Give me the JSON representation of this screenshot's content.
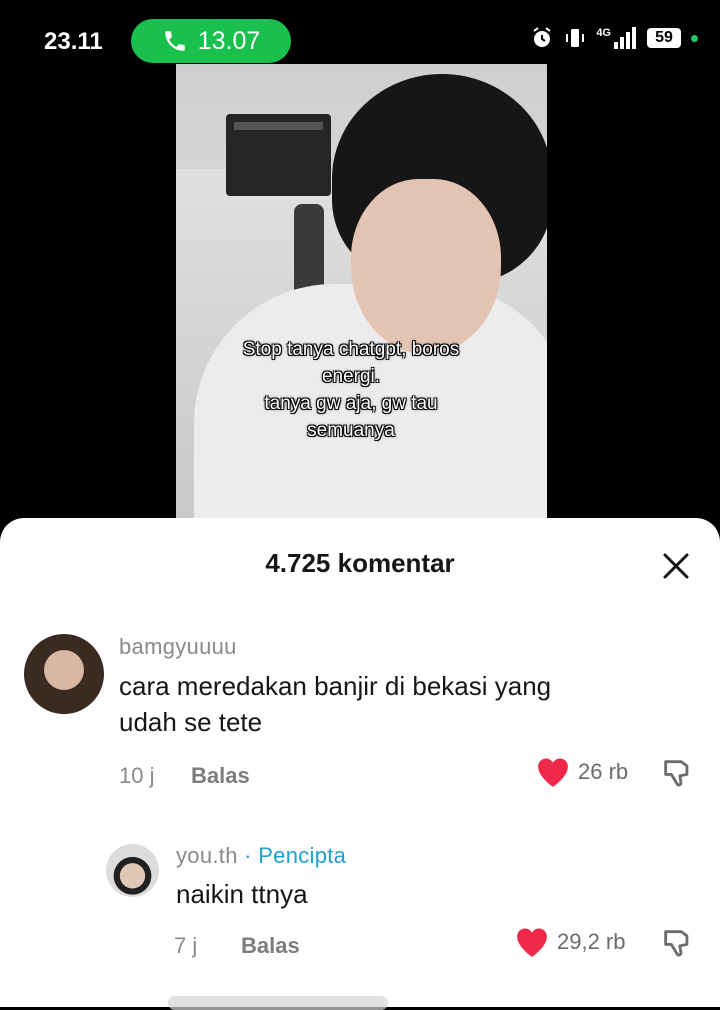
{
  "status": {
    "time": "23.11",
    "call_duration": "13.07",
    "network": "4G",
    "battery": "59"
  },
  "video": {
    "caption_lines": [
      "Stop tanya chatgpt, boros",
      "energi.",
      "tanya gw aja, gw tau",
      "semuanya"
    ]
  },
  "comments_panel": {
    "title": "4.725 komentar",
    "comments": [
      {
        "username": "bamgyuuuu",
        "text_lines": [
          "cara meredakan banjir di bekasi yang",
          "udah se tete"
        ],
        "age": "10 j",
        "reply_label": "Balas",
        "likes": "26 rb"
      },
      {
        "username": "you.th",
        "creator_label": "· Pencipta",
        "text": "naikin ttnya",
        "age": "7 j",
        "reply_label": "Balas",
        "likes": "29,2 rb"
      }
    ]
  },
  "colors": {
    "call_green": "#19c04e",
    "heart_red": "#f0284a",
    "creator_blue": "#1aa4c9"
  }
}
